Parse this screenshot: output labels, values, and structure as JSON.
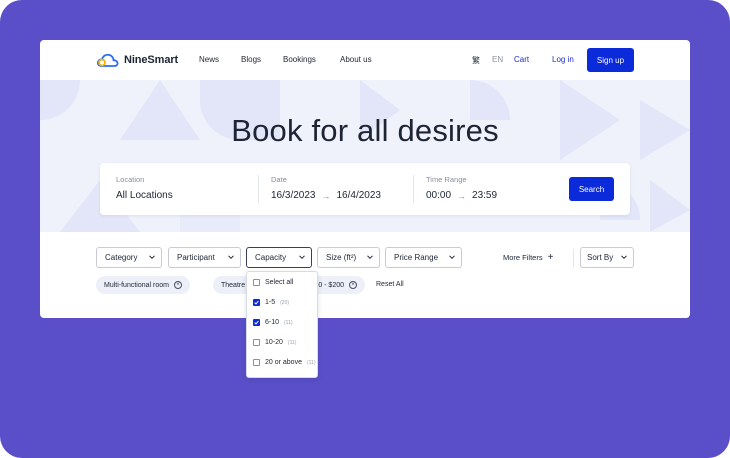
{
  "brand": {
    "name": "NineSmart"
  },
  "nav": {
    "links": [
      "News",
      "Blogs",
      "Bookings",
      "About us"
    ],
    "lang_tc": "繁",
    "lang_en": "EN",
    "cart": "Cart",
    "login": "Log in",
    "signup": "Sign up"
  },
  "hero": {
    "title": "Book for all desires"
  },
  "search": {
    "location_label": "Location",
    "location_value": "All Locations",
    "date_label": "Date",
    "date_from": "16/3/2023",
    "date_to": "16/4/2023",
    "time_label": "Time Range",
    "time_from": "00:00",
    "time_to": "23:59",
    "button": "Search"
  },
  "filters": {
    "category": "Category",
    "participant": "Participant",
    "capacity": "Capacity",
    "size": "Size (ft²)",
    "price": "Price Range",
    "more": "More Filters",
    "sort": "Sort By"
  },
  "chips": {
    "chip1": "Multi-functional room",
    "chip2_left": "Theatre",
    "chip2_right": "0 - $200",
    "reset": "Reset All"
  },
  "capacity_dropdown": {
    "options": [
      {
        "label": "Select all",
        "count": "",
        "checked": false
      },
      {
        "label": "1-5",
        "count": "(20)",
        "checked": true
      },
      {
        "label": "6-10",
        "count": "(11)",
        "checked": true
      },
      {
        "label": "10-20",
        "count": "(11)",
        "checked": false
      },
      {
        "label": "20 or above",
        "count": "(11)",
        "checked": false
      }
    ]
  },
  "colors": {
    "frame": "#5a4fc8",
    "primary": "#0b2ad9",
    "hero_bg": "#eff1fb"
  }
}
